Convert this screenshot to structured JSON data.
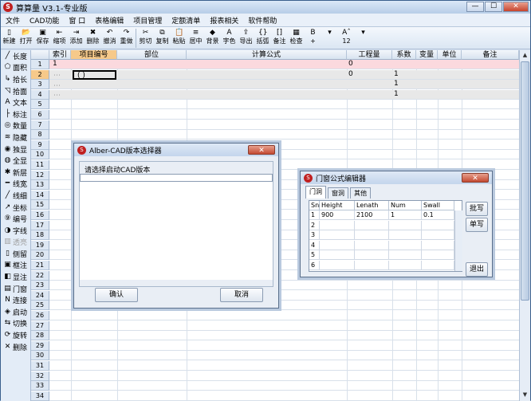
{
  "app": {
    "title": "算算量 V3.1-专业版",
    "minimize": "—",
    "maximize": "☐",
    "close": "✕"
  },
  "menu": [
    "文件",
    "CAD功能",
    "窗 口",
    "表格编辑",
    "项目管理",
    "定额清单",
    "报表相关",
    "软件帮助"
  ],
  "toolbar": [
    {
      "icon": "new-icon",
      "glyph": "▯",
      "label": "新建"
    },
    {
      "icon": "open-icon",
      "glyph": "📂",
      "label": "打开"
    },
    {
      "icon": "save-icon",
      "glyph": "▣",
      "label": "保存"
    },
    {
      "icon": "indent-icon",
      "glyph": "⇤",
      "label": "缩项"
    },
    {
      "icon": "add-icon",
      "glyph": "⇥",
      "label": "添加"
    },
    {
      "icon": "delete-icon",
      "glyph": "✖",
      "label": "删除"
    },
    {
      "icon": "undo-icon",
      "glyph": "↶",
      "label": "撤消"
    },
    {
      "icon": "redo-icon",
      "glyph": "↷",
      "label": "重做"
    },
    {
      "sep": true
    },
    {
      "icon": "cut-icon",
      "glyph": "✂",
      "label": "剪切"
    },
    {
      "icon": "copy-icon",
      "glyph": "⧉",
      "label": "复制"
    },
    {
      "icon": "paste-icon",
      "glyph": "📋",
      "label": "粘贴"
    },
    {
      "icon": "center-icon",
      "glyph": "≡",
      "label": "居中"
    },
    {
      "icon": "background-icon",
      "glyph": "◆",
      "label": "背景"
    },
    {
      "icon": "font-color-icon",
      "glyph": "A",
      "label": "字色"
    },
    {
      "icon": "export-icon",
      "glyph": "⇪",
      "label": "导出"
    },
    {
      "icon": "brace-icon",
      "glyph": "{}",
      "label": "括弧"
    },
    {
      "icon": "note-icon",
      "glyph": "[]",
      "label": "备注"
    },
    {
      "icon": "check-icon",
      "glyph": "▦",
      "label": "检查"
    },
    {
      "icon": "superscript-icon",
      "glyph": "B",
      "label": "+"
    },
    {
      "icon": "dropdown-icon",
      "glyph": "▾",
      "label": ""
    },
    {
      "icon": "font-size-icon",
      "glyph": "Aˆ",
      "label": "12"
    },
    {
      "icon": "dropdown-icon",
      "glyph": "▾",
      "label": ""
    }
  ],
  "sidebar": [
    {
      "icon": "length-icon",
      "glyph": "╱",
      "label": "长度"
    },
    {
      "icon": "area-icon",
      "glyph": "⬠",
      "label": "面积"
    },
    {
      "icon": "pick-length-icon",
      "glyph": "↳",
      "label": "拾长"
    },
    {
      "icon": "pick-area-icon",
      "glyph": "◹",
      "label": "拾面"
    },
    {
      "icon": "text-icon",
      "glyph": "A",
      "label": "文本"
    },
    {
      "icon": "annotate-icon",
      "glyph": "├",
      "label": "标注"
    },
    {
      "icon": "count-icon",
      "glyph": "◎",
      "label": "数量"
    },
    {
      "icon": "hide-icon",
      "glyph": "≋",
      "label": "隐藏"
    },
    {
      "icon": "show-only-icon",
      "glyph": "◉",
      "label": "独显"
    },
    {
      "icon": "show-all-icon",
      "glyph": "◍",
      "label": "全显"
    },
    {
      "icon": "new-layer-icon",
      "glyph": "✱",
      "label": "新层"
    },
    {
      "icon": "line-width-icon",
      "glyph": "━",
      "label": "线宽"
    },
    {
      "icon": "line-thin-icon",
      "glyph": "╱",
      "label": "线细"
    },
    {
      "icon": "coordinate-icon",
      "glyph": "↗",
      "label": "坐标"
    },
    {
      "icon": "number-icon",
      "glyph": "⑨",
      "label": "编号"
    },
    {
      "icon": "font-icon",
      "glyph": "◑",
      "label": "字线"
    },
    {
      "icon": "transparent-icon",
      "glyph": "▥",
      "label": "透亮",
      "disabled": true
    },
    {
      "icon": "side-icon",
      "glyph": "▯",
      "label": "侧留"
    },
    {
      "icon": "frame-note-icon",
      "glyph": "▣",
      "label": "框注"
    },
    {
      "icon": "show-note-icon",
      "glyph": "◧",
      "label": "显注"
    },
    {
      "icon": "door-window-icon",
      "glyph": "▤",
      "label": "门窗"
    },
    {
      "icon": "connect-icon",
      "glyph": "N",
      "label": "连接"
    },
    {
      "icon": "start-icon",
      "glyph": "◈",
      "label": "启动"
    },
    {
      "icon": "switch-icon",
      "glyph": "⇆",
      "label": "切换"
    },
    {
      "icon": "rotate-icon",
      "glyph": "⟳",
      "label": "旋转"
    },
    {
      "icon": "remove-icon",
      "glyph": "✕",
      "label": "删除"
    }
  ],
  "grid": {
    "columns": [
      "索引",
      "项目编号",
      "部位",
      "计算公式",
      "工程量",
      "系数",
      "变量",
      "单位",
      "备注"
    ],
    "row_numbers": [
      "1",
      "2",
      "3",
      "4",
      "5",
      "6",
      "7",
      "8",
      "9",
      "10",
      "11",
      "12",
      "13",
      "14",
      "15",
      "16",
      "17",
      "18",
      "19",
      "20",
      "21",
      "22",
      "23",
      "24",
      "25",
      "26",
      "27",
      "28",
      "29",
      "30",
      "31",
      "32",
      "33",
      "34"
    ],
    "rows": [
      {
        "index": "1",
        "code": "",
        "qty": "0",
        "coef": ""
      },
      {
        "index": "",
        "code": "( )",
        "qty": "0",
        "coef": "1"
      },
      {
        "index": "",
        "code": "",
        "qty": "",
        "coef": "1"
      },
      {
        "index": "",
        "code": "",
        "qty": "",
        "coef": "1"
      }
    ]
  },
  "dialog_cad": {
    "title": "Alber-CAD版本选择器",
    "close": "✕",
    "prompt": "请选择启动CAD版本",
    "ok": "确认",
    "cancel": "取消"
  },
  "dialog_door": {
    "title": "门窗公式编辑器",
    "close": "✕",
    "tabs": [
      "门洞",
      "窗洞",
      "其他"
    ],
    "headers": [
      "Snm",
      "Height",
      "Lenath",
      "Num",
      "Swall"
    ],
    "rows": [
      [
        "1",
        "900",
        "2100",
        "1",
        "0.1"
      ],
      [
        "2",
        "",
        "",
        "",
        ""
      ],
      [
        "3",
        "",
        "",
        "",
        ""
      ],
      [
        "4",
        "",
        "",
        "",
        ""
      ],
      [
        "5",
        "",
        "",
        "",
        ""
      ],
      [
        "6",
        "",
        "",
        "",
        ""
      ]
    ],
    "btn_batch": "批写",
    "btn_single": "单写",
    "btn_exit": "退出"
  }
}
